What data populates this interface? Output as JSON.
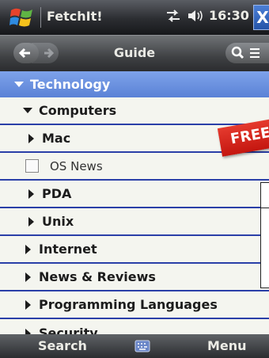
{
  "statusbar": {
    "app_title": "FetchIt!",
    "time": "16:30",
    "close_glyph": "X",
    "icons": [
      "start-icon",
      "connectivity-icon",
      "volume-icon"
    ]
  },
  "toolbar": {
    "title": "Guide"
  },
  "list": {
    "category": "Technology",
    "items": [
      {
        "label": "Computers",
        "kind": "expanded"
      },
      {
        "label": "Mac",
        "kind": "collapsed"
      },
      {
        "label": "OS News",
        "kind": "feed"
      },
      {
        "label": "PDA",
        "kind": "collapsed"
      },
      {
        "label": "Unix",
        "kind": "collapsed"
      },
      {
        "label": "Internet",
        "kind": "collapsed"
      },
      {
        "label": "News & Reviews",
        "kind": "collapsed"
      },
      {
        "label": "Programming Languages",
        "kind": "collapsed"
      },
      {
        "label": "Security",
        "kind": "collapsed"
      }
    ]
  },
  "banner": {
    "text": "FREE"
  },
  "bottombar": {
    "left": "Search",
    "right": "Menu"
  },
  "colors": {
    "header_blue": "#6a91e0",
    "row_line": "#2a3fa8",
    "banner_red": "#d42218"
  }
}
